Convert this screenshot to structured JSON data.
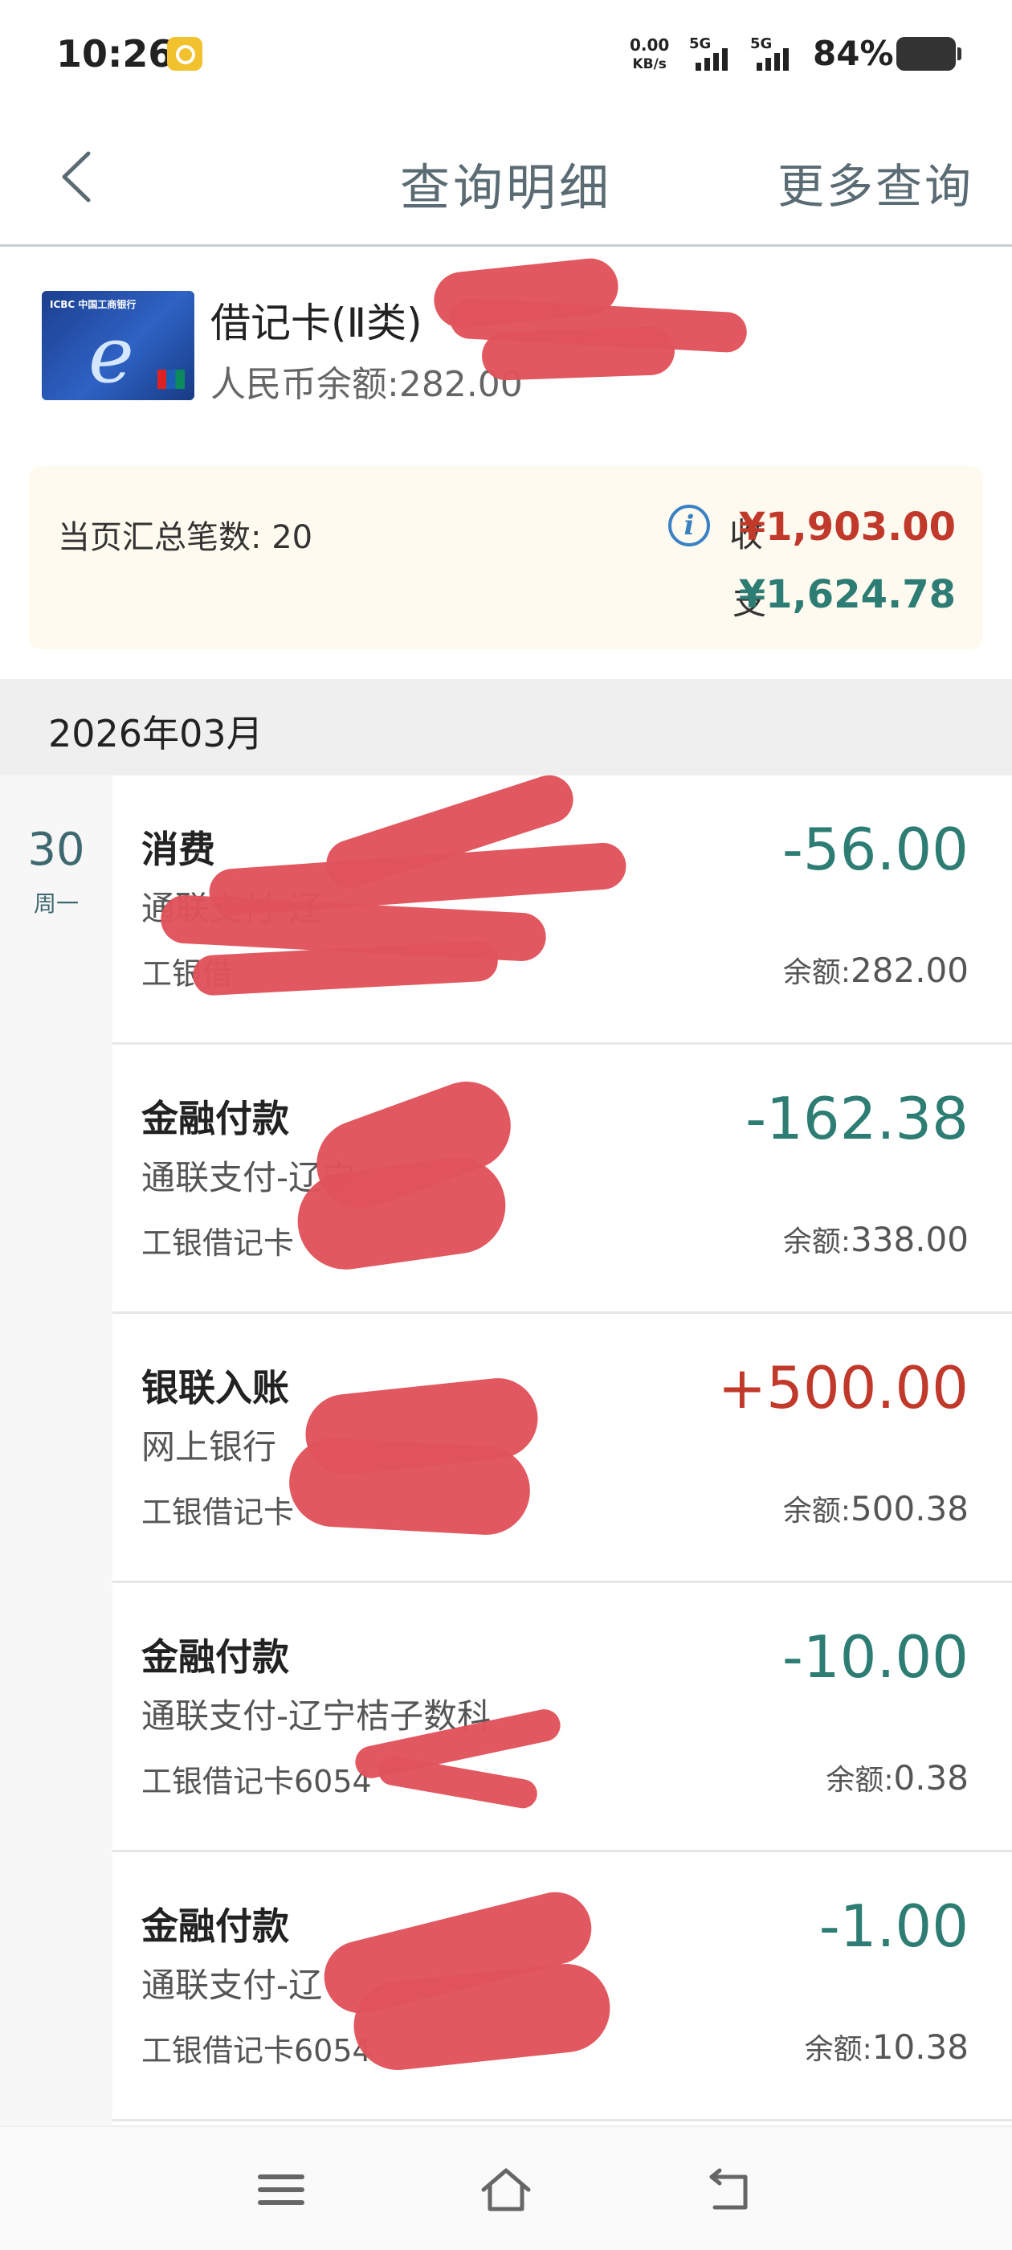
{
  "status_bar": {
    "time": "10:26",
    "net_speed_value": "0.00",
    "net_speed_unit": "KB/s",
    "sim1": "5G",
    "sim2": "5G",
    "battery": "84%"
  },
  "nav": {
    "title": "查询明细",
    "more": "更多查询",
    "back_icon": "chevron-left-icon"
  },
  "card": {
    "name": "借记卡(Ⅱ类)",
    "balance": "人民币余额:282.00",
    "bank_label": "ICBC 中国工商银行"
  },
  "summary": {
    "count": "当页汇总笔数: 20",
    "income_label": "收",
    "income": "¥1,903.00",
    "expense_label": "支",
    "expense": "¥1,624.78"
  },
  "month": "2026年03月",
  "date": {
    "day": "30",
    "weekday": "周一"
  },
  "transactions": [
    {
      "type": "消费",
      "desc": "通联支付-辽",
      "card": "工银借",
      "amount": "-56.00",
      "balance_label": "余额:",
      "balance": "282.00",
      "positive": false
    },
    {
      "type": "金融付款",
      "desc": "通联支付-辽宁",
      "card": "工银借记卡",
      "amount": "-162.38",
      "balance_label": "余额:",
      "balance": "338.00",
      "positive": false
    },
    {
      "type": "银联入账",
      "desc": "网上银行",
      "card": "工银借记卡",
      "amount": "+500.00",
      "balance_label": "余额:",
      "balance": "500.38",
      "positive": true
    },
    {
      "type": "金融付款",
      "desc": "通联支付-辽宁桔子数科",
      "card": "工银借记卡6054",
      "amount": "-10.00",
      "balance_label": "余额:",
      "balance": "0.38",
      "positive": false
    },
    {
      "type": "金融付款",
      "desc": "通联支付-辽",
      "card": "工银借记卡6054",
      "amount": "-1.00",
      "balance_label": "余额:",
      "balance": "10.38",
      "positive": false
    }
  ],
  "colors": {
    "income": "#c0392b",
    "expense": "#2e7d74",
    "redaction": "#e0535b"
  }
}
